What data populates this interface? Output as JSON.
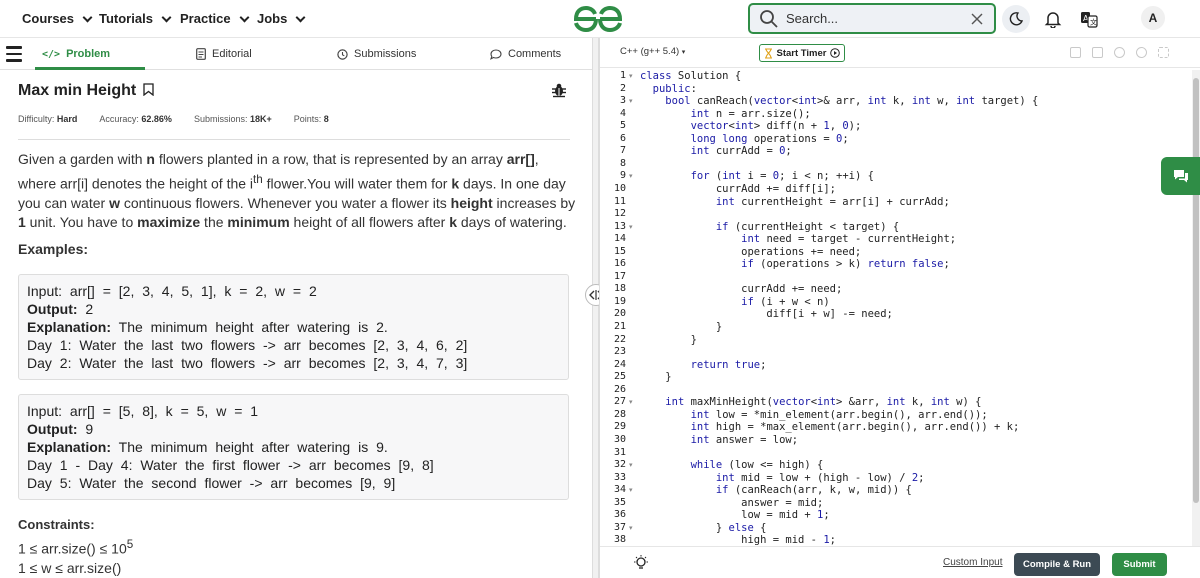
{
  "nav": {
    "items": [
      "Courses",
      "Tutorials",
      "Practice",
      "Jobs"
    ],
    "search_placeholder": "Search...",
    "avatar": "A"
  },
  "tabs": [
    {
      "label": "Problem",
      "icon": "code-icon"
    },
    {
      "label": "Editorial",
      "icon": "document-icon"
    },
    {
      "label": "Submissions",
      "icon": "clock-icon"
    },
    {
      "label": "Comments",
      "icon": "chat-bubble-icon"
    }
  ],
  "problem": {
    "title": "Max min Height",
    "meta": {
      "difficulty_label": "Difficulty:",
      "difficulty": "Hard",
      "accuracy_label": "Accuracy:",
      "accuracy": "62.86%",
      "submissions_label": "Submissions:",
      "submissions": "18K+",
      "points_label": "Points:",
      "points": "8"
    },
    "statement": {
      "p1": "Given a garden with ",
      "n": "n",
      "p2": " flowers planted in a row, that is represented by an array ",
      "arr": "arr[]",
      "p3": ", where arr[i] denotes the height of the i",
      "sup": "th",
      "p4": " flower.You will water them for ",
      "k": "k",
      "p5": " days. In one day you can water ",
      "w": "w",
      "p6": " continuous flowers. Whenever you water a flower its ",
      "height": "height",
      "p7": " increases by ",
      "one": "1",
      "p8": " unit. You have to ",
      "maximize": "maximize",
      "p9": " the ",
      "minimum": "minimum",
      "p10": " height of all flowers after  ",
      "k2": "k",
      "p11": " days of watering."
    },
    "examples_heading": "Examples:",
    "examples": [
      {
        "input_label": "Input:",
        "input": "arr[] = [2, 3, 4, 5, 1], k = 2, w = 2",
        "output_label": "Output:",
        "output": "2",
        "explanation_label": "Explanation:",
        "explanation": "The minimum height after watering is 2.",
        "lines": [
          "Day 1: Water the last two flowers -> arr becomes [2, 3, 4, 6, 2]",
          "Day 2: Water the last two flowers -> arr becomes [2, 3, 4, 7, 3]"
        ]
      },
      {
        "input_label": "Input:",
        "input": "arr[] = [5, 8], k = 5, w = 1",
        "output_label": "Output:",
        "output": "9",
        "explanation_label": "Explanation:",
        "explanation": "The minimum height after watering is 9.",
        "lines": [
          "Day 1 - Day 4: Water the first flower -> arr becomes [9, 8]",
          "Day 5: Water the second flower -> arr becomes [9, 9]"
        ]
      }
    ],
    "constraints_heading": "Constraints:",
    "constraint1": "1 ≤ arr.size() ≤ 10",
    "constraint1_sup": "5",
    "constraint2": "1 ≤ w ≤ arr.size()"
  },
  "editor": {
    "language": "C++ (g++ 5.4)",
    "timer_label": "Start Timer",
    "code_lines": [
      "class Solution {",
      "  public:",
      "    bool canReach(vector<int>& arr, int k, int w, int target) {",
      "        int n = arr.size();",
      "        vector<int> diff(n + 1, 0);",
      "        long long operations = 0;",
      "        int currAdd = 0;",
      "",
      "        for (int i = 0; i < n; ++i) {",
      "            currAdd += diff[i];",
      "            int currentHeight = arr[i] + currAdd;",
      "",
      "            if (currentHeight < target) {",
      "                int need = target - currentHeight;",
      "                operations += need;",
      "                if (operations > k) return false;",
      "",
      "                currAdd += need;",
      "                if (i + w < n)",
      "                    diff[i + w] -= need;",
      "            }",
      "        }",
      "",
      "        return true;",
      "    }",
      "",
      "    int maxMinHeight(vector<int> &arr, int k, int w) {",
      "        int low = *min_element(arr.begin(), arr.end());",
      "        int high = *max_element(arr.begin(), arr.end()) + k;",
      "        int answer = low;",
      "",
      "        while (low <= high) {",
      "            int mid = low + (high - low) / 2;",
      "            if (canReach(arr, k, w, mid)) {",
      "                answer = mid;",
      "                low = mid + 1;",
      "            } else {",
      "                high = mid - 1;"
    ],
    "fold_lines": [
      1,
      3,
      9,
      13,
      27,
      32,
      34,
      37
    ],
    "custom_input": "Custom Input",
    "compile_label": "Compile & Run",
    "submit_label": "Submit"
  },
  "colors": {
    "accent": "#2f8d46",
    "keyword": "#1a1aa6",
    "compile_bg": "#3c4a54"
  }
}
